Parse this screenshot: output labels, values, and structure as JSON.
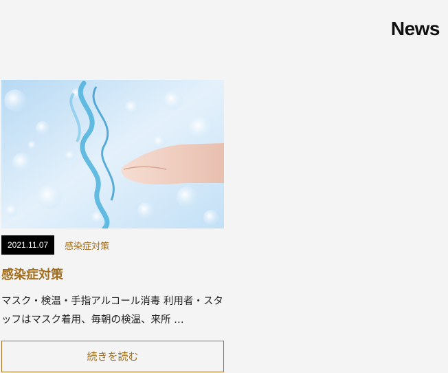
{
  "section": {
    "title": "News"
  },
  "post": {
    "image_alt": "水しぶきと手",
    "date": "2021.11.07",
    "category": "感染症対策",
    "title": "感染症対策",
    "excerpt": "マスク・検温・手指アルコール消毒 利用者・スタッフはマスク着用、毎朝の検温、来所 …",
    "read_more": "続きを読む"
  },
  "colors": {
    "accent": "#a16d1c",
    "date_bg": "#000000",
    "background": "#f4f4f4"
  }
}
